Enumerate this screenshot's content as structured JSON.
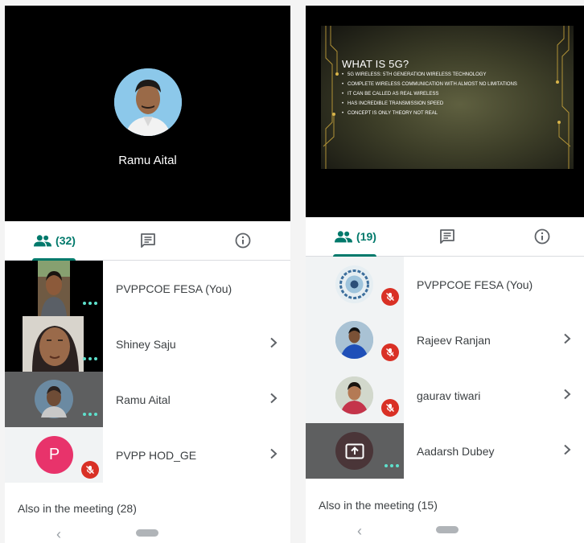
{
  "left_screen": {
    "speaker": {
      "name": "Ramu Aital"
    },
    "tabs": {
      "people_count": "(32)"
    },
    "participants": [
      {
        "name": "PVPPCOE FESA (You)"
      },
      {
        "name": "Shiney Saju"
      },
      {
        "name": "Ramu Aital"
      },
      {
        "name": "PVPP HOD_GE",
        "initial": "P"
      }
    ],
    "also_in_meeting": "Also in the meeting (28)"
  },
  "right_screen": {
    "slide": {
      "title": "WHAT IS 5G?",
      "bullets": [
        "5G WIRELESS: 5TH GENERATION WIRELESS TECHNOLOGY",
        "COMPLETE WIRELESS COMMUNICATION WITH ALMOST NO LIMITATIONS",
        "IT CAN BE CALLED AS REAL WIRELESS",
        "HAS INCREDIBLE TRANSMISSION SPEED",
        "CONCEPT IS ONLY THEORY NOT REAL"
      ]
    },
    "tabs": {
      "people_count": "(19)"
    },
    "participants": [
      {
        "name": "PVPPCOE FESA (You)"
      },
      {
        "name": "Rajeev Ranjan"
      },
      {
        "name": "gaurav tiwari"
      },
      {
        "name": "Aadarsh Dubey"
      }
    ],
    "also_in_meeting": "Also in the meeting (15)"
  },
  "colors": {
    "accent": "#00796b",
    "mute_red": "#d93025",
    "speaking_dots": "#5ee0cc",
    "avatar_pink": "#e8336b"
  },
  "icons": [
    "people-icon",
    "chat-icon",
    "info-icon",
    "chevron-right-icon",
    "mic-off-icon",
    "present-screen-icon",
    "back-icon",
    "home-pill"
  ]
}
